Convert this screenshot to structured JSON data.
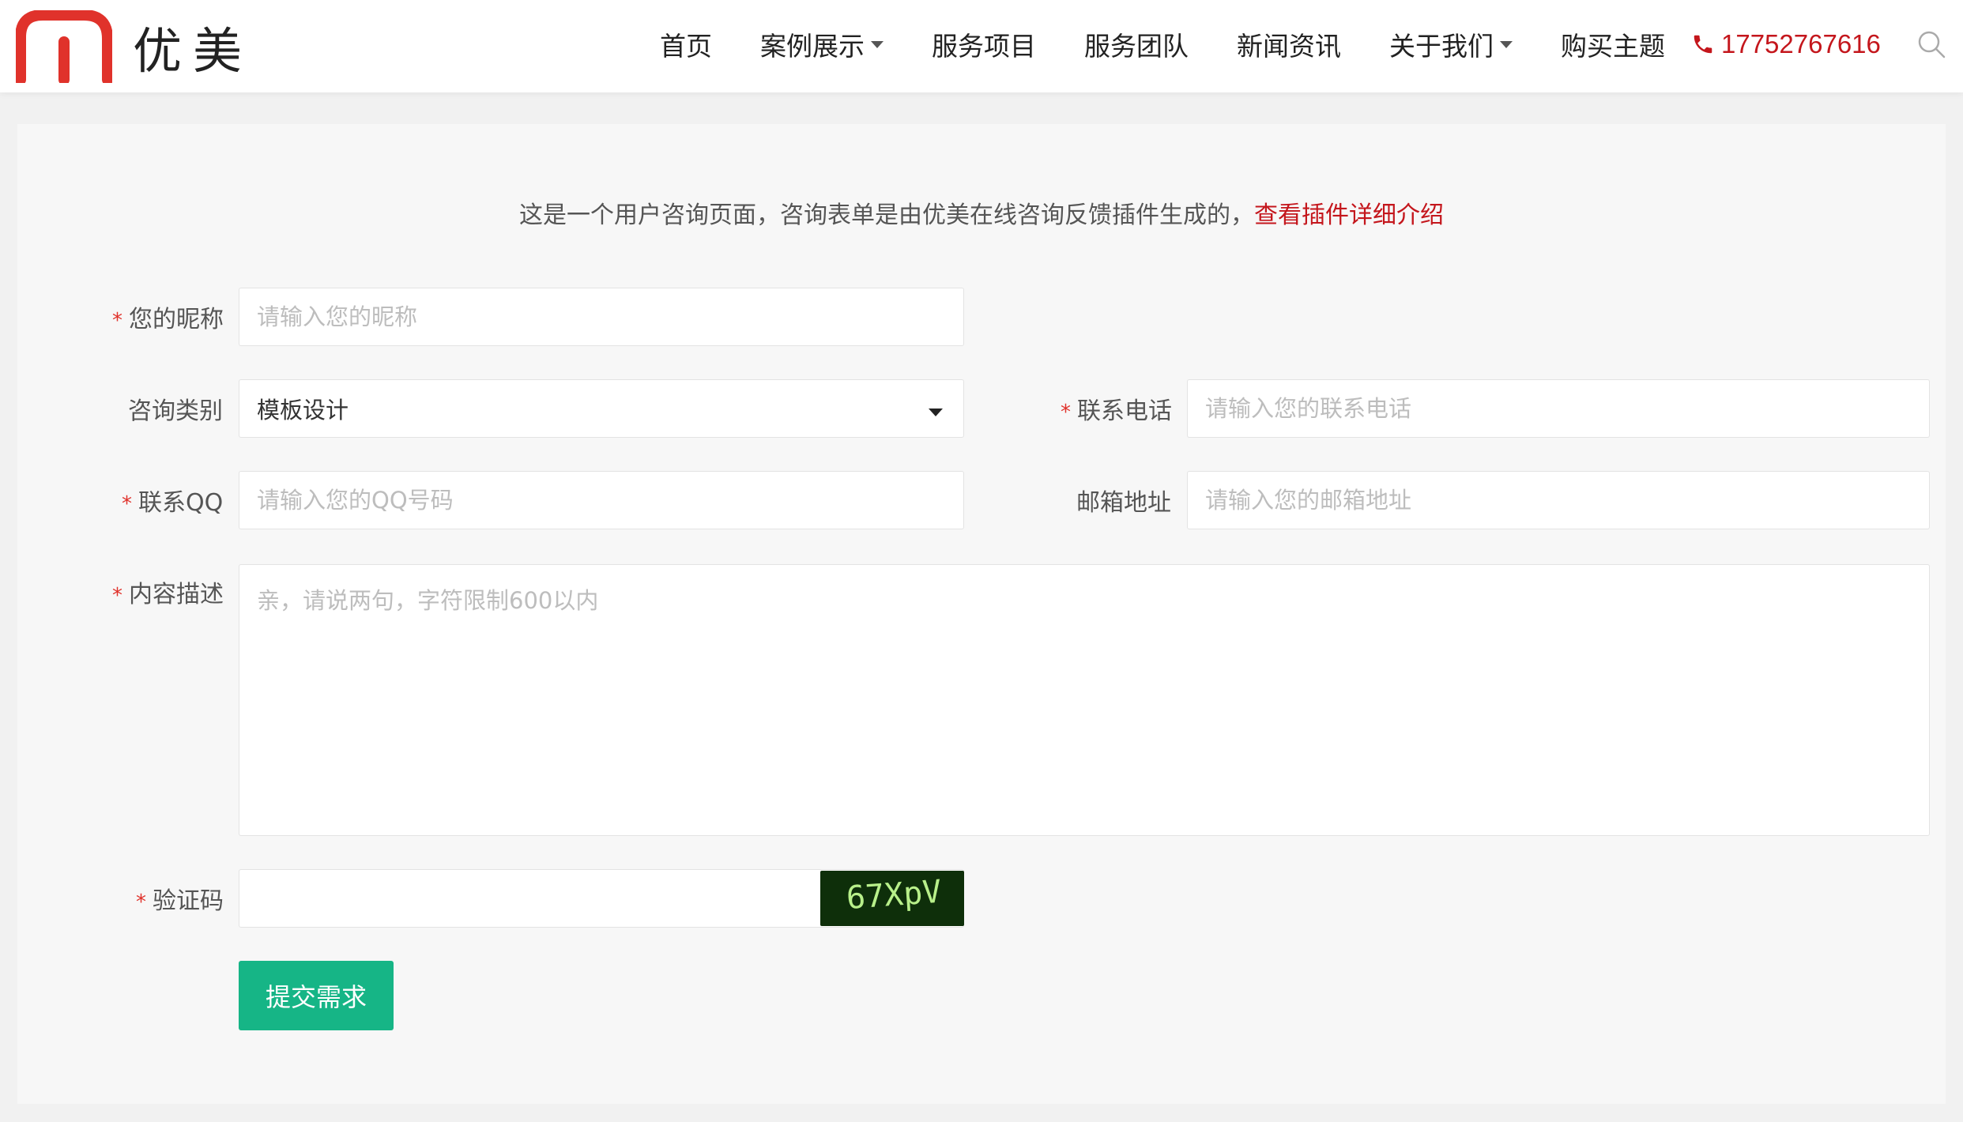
{
  "brand": {
    "name": "优美",
    "accent": "#e0322b"
  },
  "nav": {
    "items": [
      {
        "label": "首页",
        "dropdown": false
      },
      {
        "label": "案例展示",
        "dropdown": true
      },
      {
        "label": "服务项目",
        "dropdown": false
      },
      {
        "label": "服务团队",
        "dropdown": false
      },
      {
        "label": "新闻资讯",
        "dropdown": false
      },
      {
        "label": "关于我们",
        "dropdown": true
      },
      {
        "label": "购买主题",
        "dropdown": false
      }
    ],
    "phone": "17752767616",
    "phone_color": "#c4161c"
  },
  "intro": {
    "text": "这是一个用户咨询页面，咨询表单是由优美在线咨询反馈插件生成的，",
    "link": "查看插件详细介绍"
  },
  "form": {
    "required_mark": "*",
    "nickname": {
      "label": "您的昵称",
      "placeholder": "请输入您的昵称"
    },
    "category": {
      "label": "咨询类别",
      "value": "模板设计"
    },
    "phone": {
      "label": "联系电话",
      "placeholder": "请输入您的联系电话"
    },
    "qq": {
      "label": "联系QQ",
      "placeholder": "请输入您的QQ号码"
    },
    "email": {
      "label": "邮箱地址",
      "placeholder": "请输入您的邮箱地址"
    },
    "content": {
      "label": "内容描述",
      "placeholder": "亲，请说两句，字符限制600以内"
    },
    "captcha": {
      "label": "验证码",
      "image_text": "67XpV"
    },
    "submit_label": "提交需求",
    "submit_color": "#16b586"
  }
}
